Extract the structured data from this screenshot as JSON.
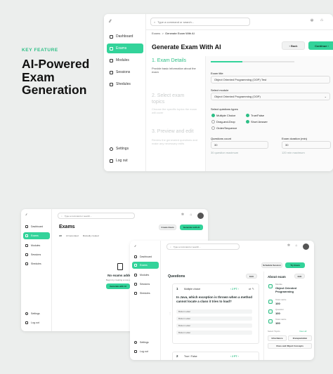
{
  "hero": {
    "kicker": "KEY FEATURE",
    "title": "AI-Powered Exam Generation"
  },
  "icons": {
    "logo": "logo-mark",
    "search": "search-icon",
    "dashboard": "grid-icon",
    "exams": "file-icon",
    "modules": "layers-icon",
    "sessions": "calendar-icon",
    "schedules": "clock-icon",
    "settings": "gear-icon",
    "logout": "logout-icon"
  },
  "sidebar": {
    "logo": "⁄∕",
    "items": [
      "Dashboard",
      "Exams",
      "Modules",
      "Sessions",
      "Shedules"
    ],
    "footer": [
      "Settings",
      "Log out"
    ]
  },
  "screen1": {
    "search_placeholder": "Type a command or search...",
    "breadcrumb": [
      "Exams",
      "Generate Exam With AI"
    ],
    "page_title": "Generate Exam With AI",
    "back_label": "Back",
    "continue_label": "Continue",
    "steps": [
      {
        "title": "1. Exam Details",
        "desc": "Provide basic information about the exam"
      },
      {
        "title": "2. Select exam topics",
        "desc": "Choose the specific topics the exam will cover"
      },
      {
        "title": "3. Preview and edit",
        "desc": "Review the generated questions and make any necessary edits"
      }
    ],
    "exam_title_label": "Exam title",
    "exam_title_value": "Object Oriented Programming (OOP) Test",
    "module_label": "Select module",
    "module_value": "Object Oriented Programming (OOP)",
    "qtypes_label": "Select quistions types",
    "qtypes": [
      {
        "label": "Multiple Choice",
        "checked": true
      },
      {
        "label": "True/False",
        "checked": true
      },
      {
        "label": "Drag-and-Drop",
        "checked": false
      },
      {
        "label": "Short Answer",
        "checked": true
      },
      {
        "label": "Order/Sequence",
        "checked": false
      }
    ],
    "count_label": "Questions count",
    "count_value": "30",
    "count_hint": "30 question maximum",
    "duration_label": "Exam duration (min)",
    "duration_value": "30",
    "duration_hint": "120 min maximum",
    "progress": 0.38
  },
  "screen2": {
    "search_placeholder": "Type a command or search...",
    "page_title": "Exams",
    "create_label": "Create Exam",
    "generate_label": "Generate with AI",
    "filters": [
      "All",
      "AI Generated",
      "Manually created"
    ],
    "empty_title": "No exams added",
    "empty_desc": "Begin by creating a new exam",
    "empty_button": "Generate with AI"
  },
  "screen3": {
    "search_placeholder": "Type a command or search...",
    "schedule_label": "Schedule Session",
    "try_label": "Try Exam",
    "questions_title": "Questions",
    "edit_label": "Edit",
    "q1": {
      "num": "1",
      "type": "Multiple choice",
      "points": "2 PT",
      "text": "In Java, which exception is thrown when a method cannot locate a class it tries to load?",
      "options": [
        "Button Label",
        "Button Label",
        "Button Label",
        "Button Label"
      ]
    },
    "q2": {
      "num": "2",
      "type": "True / False",
      "points": "2 PT"
    },
    "about_title": "About exam",
    "about_edit": "Edit",
    "module_label": "Module",
    "module_value": "Object Oriented Programming",
    "total_marks_label": "Total marks",
    "total_marks_value": "100",
    "question_label": "Question",
    "question_value": "100",
    "total_marks2_label": "Total marks",
    "total_marks2_value": "100",
    "topics_label": "Select Topics",
    "view_all": "View all",
    "topics": [
      "Inheritance",
      "Encapsulation",
      "Class and Object Concepts"
    ]
  },
  "colors": {
    "accent": "#33d39a",
    "accent_text": "#2dbf86",
    "background": "#eceeed"
  }
}
